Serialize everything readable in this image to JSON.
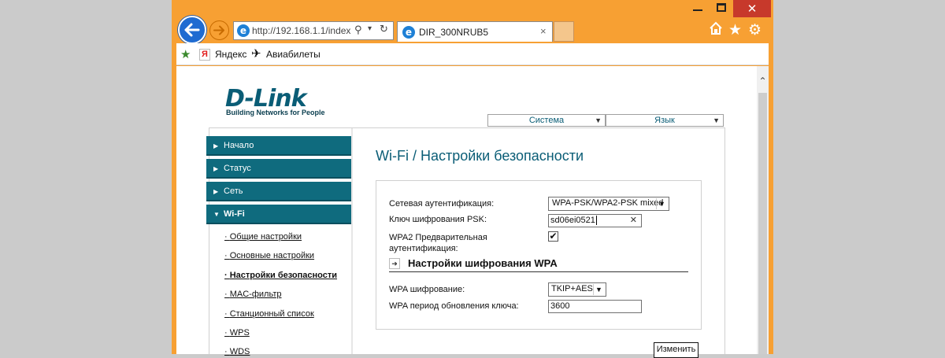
{
  "window": {
    "minimize_glyph": "",
    "close_glyph": "✕"
  },
  "toolbar": {
    "address": "http://192.168.1.1/index",
    "tab_title": "DIR_300NRUB5",
    "tab_close": "×",
    "search_glyph": "⚲",
    "dropdown_glyph": "▾",
    "refresh_glyph": "↻"
  },
  "favorites": {
    "yandex_label": "Яндекс",
    "avia_label": "Авиабилеты",
    "yandex_glyph": "Я",
    "plane_glyph": "✈",
    "add_glyph": "★"
  },
  "header": {
    "logo": "D-Link",
    "tagline": "Building Networks for People",
    "system_menu": "Система",
    "language_menu": "Язык"
  },
  "sidebar": {
    "items": [
      {
        "label": "Начало"
      },
      {
        "label": "Статус"
      },
      {
        "label": "Сеть"
      },
      {
        "label": "Wi-Fi"
      }
    ],
    "wifi_subitems": [
      {
        "label": "Общие настройки"
      },
      {
        "label": "Основные настройки"
      },
      {
        "label": "Настройки безопасности"
      },
      {
        "label": "MAC-фильтр"
      },
      {
        "label": "Станционный список"
      },
      {
        "label": "WPS"
      },
      {
        "label": "WDS"
      }
    ]
  },
  "main": {
    "title": "Wi-Fi  / Настройки безопасности",
    "auth_label": "Сетевая аутентификация:",
    "auth_value": "WPA-PSK/WPA2-PSK mixed",
    "psk_label": "Ключ шифрования PSK:",
    "psk_value": "sd06ei0521",
    "wpa2_label_line1": "WPA2 Предварительная",
    "wpa2_label_line2": "аутентификация:",
    "wpa2_checked": true,
    "wpa_section_title": "Настройки шифрования WPA",
    "wpa_enc_label": "WPA шифрование:",
    "wpa_enc_value": "TKIP+AES",
    "wpa_period_label": "WPA период обновления ключа:",
    "wpa_period_value": "3600",
    "change_button": "Изменить"
  },
  "colors": {
    "frame": "#f7a033",
    "brand": "#0a5d76",
    "nav_bg": "#0f6b7e"
  }
}
